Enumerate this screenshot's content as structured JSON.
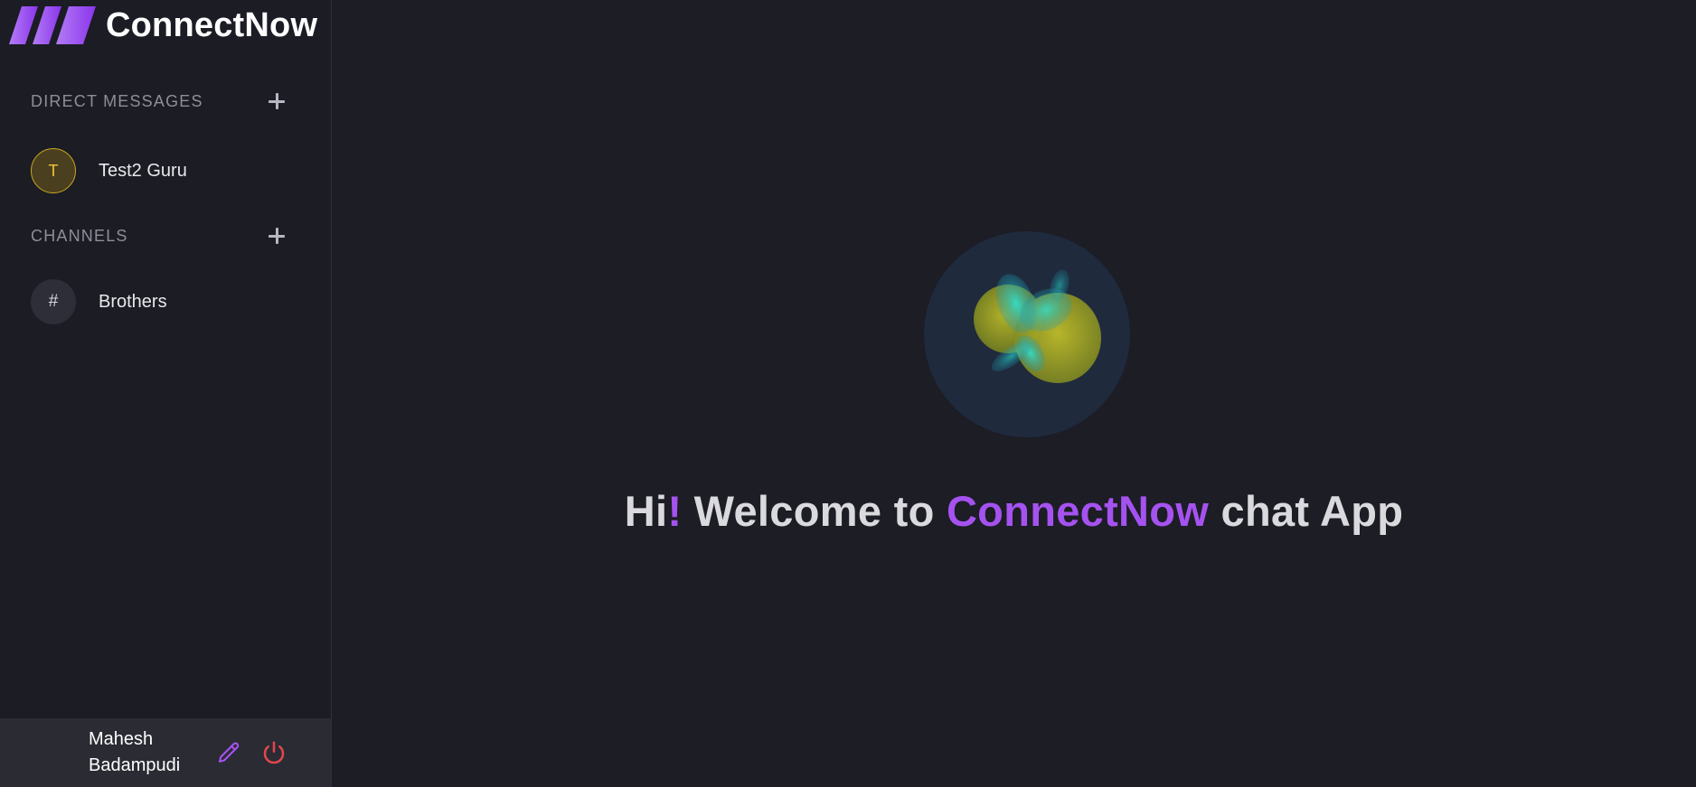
{
  "brand": {
    "name": "ConnectNow"
  },
  "sidebar": {
    "direct_messages": {
      "title": "DIRECT MESSAGES",
      "items": [
        {
          "initial": "T",
          "label": "Test2 Guru"
        }
      ]
    },
    "channels": {
      "title": "CHANNELS",
      "items": [
        {
          "symbol": "#",
          "label": "Brothers"
        }
      ]
    }
  },
  "user": {
    "first_name": "Mahesh",
    "last_name": "Badampudi"
  },
  "welcome": {
    "part1": "Hi",
    "exclaim": "!",
    "part2": "Welcome to",
    "app_name": "ConnectNow",
    "part3": "chat App"
  },
  "icons": {
    "logo": "slanted-bars-logo-icon",
    "add": "plus-icon",
    "edit": "pencil-icon",
    "logout": "power-icon",
    "hero": "lottie-orb-icon"
  },
  "colors": {
    "accent": "#a552f0",
    "logout": "#e0474c",
    "dm_avatar": "#f2c531",
    "background": "#1c1d25"
  }
}
